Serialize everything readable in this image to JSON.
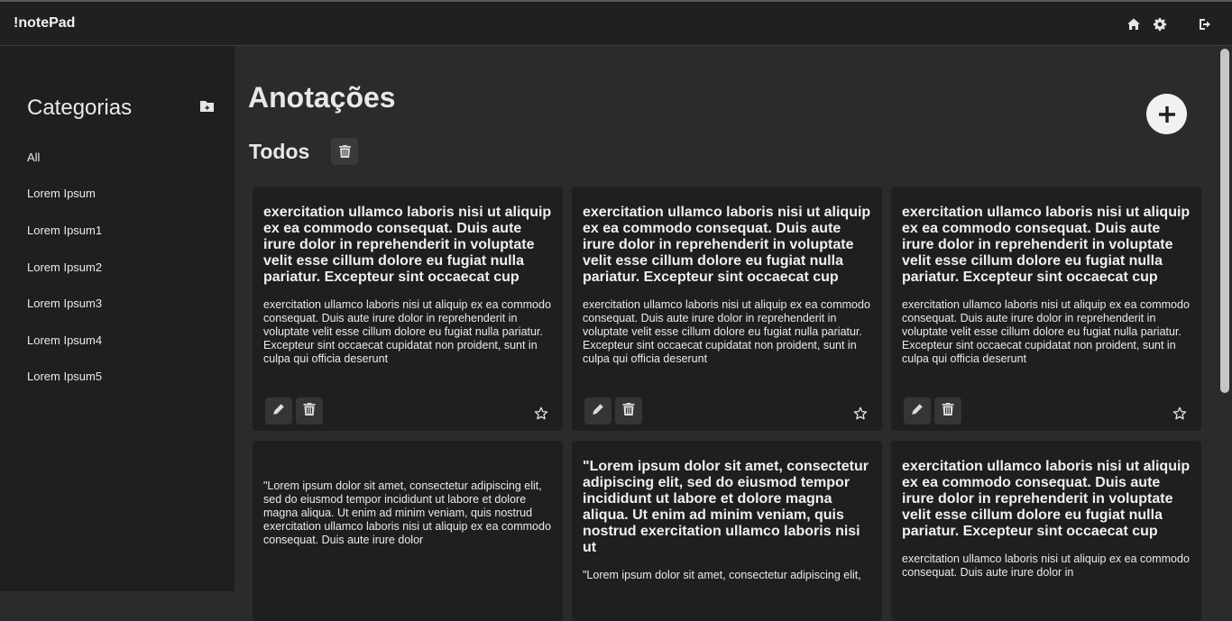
{
  "app": {
    "brand": "!notePad"
  },
  "topbar": {
    "icons": [
      "home-icon",
      "gear-icon",
      "logout-icon"
    ]
  },
  "sidebar": {
    "title": "Categorias",
    "add_icon": "folder-plus-icon",
    "categories": [
      "All",
      "Lorem Ipsum",
      "Lorem Ipsum1",
      "Lorem Ipsum2",
      "Lorem Ipsum3",
      "Lorem Ipsum4",
      "Lorem Ipsum5"
    ]
  },
  "main": {
    "title": "Anotações",
    "section": "Todos"
  },
  "notes": [
    {
      "title": "exercitation ullamco laboris nisi ut aliquip ex ea commodo consequat. Duis aute irure dolor in reprehenderit in voluptate velit esse cillum dolore eu fugiat nulla pariatur. Excepteur sint occaecat cup",
      "body": "exercitation ullamco laboris nisi ut aliquip ex ea commodo consequat. Duis aute irure dolor in reprehenderit in voluptate velit esse cillum dolore eu fugiat nulla pariatur. Excepteur sint occaecat cupidatat non proident, sunt in culpa qui officia deserunt"
    },
    {
      "title": "exercitation ullamco laboris nisi ut aliquip ex ea commodo consequat. Duis aute irure dolor in reprehenderit in voluptate velit esse cillum dolore eu fugiat nulla pariatur. Excepteur sint occaecat cup",
      "body": "exercitation ullamco laboris nisi ut aliquip ex ea commodo consequat. Duis aute irure dolor in reprehenderit in voluptate velit esse cillum dolore eu fugiat nulla pariatur. Excepteur sint occaecat cupidatat non proident, sunt in culpa qui officia deserunt"
    },
    {
      "title": "exercitation ullamco laboris nisi ut aliquip ex ea commodo consequat. Duis aute irure dolor in reprehenderit in voluptate velit esse cillum dolore eu fugiat nulla pariatur. Excepteur sint occaecat cup",
      "body": "exercitation ullamco laboris nisi ut aliquip ex ea commodo consequat. Duis aute irure dolor in reprehenderit in voluptate velit esse cillum dolore eu fugiat nulla pariatur. Excepteur sint occaecat cupidatat non proident, sunt in culpa qui officia deserunt"
    },
    {
      "title": "",
      "body": "\"Lorem ipsum dolor sit amet, consectetur adipiscing elit, sed do eiusmod tempor incididunt ut labore et dolore magna aliqua. Ut enim ad minim veniam, quis nostrud exercitation ullamco laboris nisi ut aliquip ex ea commodo consequat. Duis aute irure dolor"
    },
    {
      "title": "\"Lorem ipsum dolor sit amet, consectetur adipiscing elit, sed do eiusmod tempor incididunt ut labore et dolore magna aliqua. Ut enim ad minim veniam, quis nostrud exercitation ullamco laboris nisi ut",
      "body": "\"Lorem ipsum dolor sit amet, consectetur adipiscing elit,"
    },
    {
      "title": "exercitation ullamco laboris nisi ut aliquip ex ea commodo consequat. Duis aute irure dolor in reprehenderit in voluptate velit esse cillum dolore eu fugiat nulla pariatur. Excepteur sint occaecat cup",
      "body": "exercitation ullamco laboris nisi ut aliquip ex ea commodo consequat. Duis aute irure dolor in"
    }
  ],
  "colors": {
    "background": "#2b2b2b",
    "sidebar": "#1f1f1f",
    "card": "#1f1f1f",
    "topbar": "#202020"
  }
}
